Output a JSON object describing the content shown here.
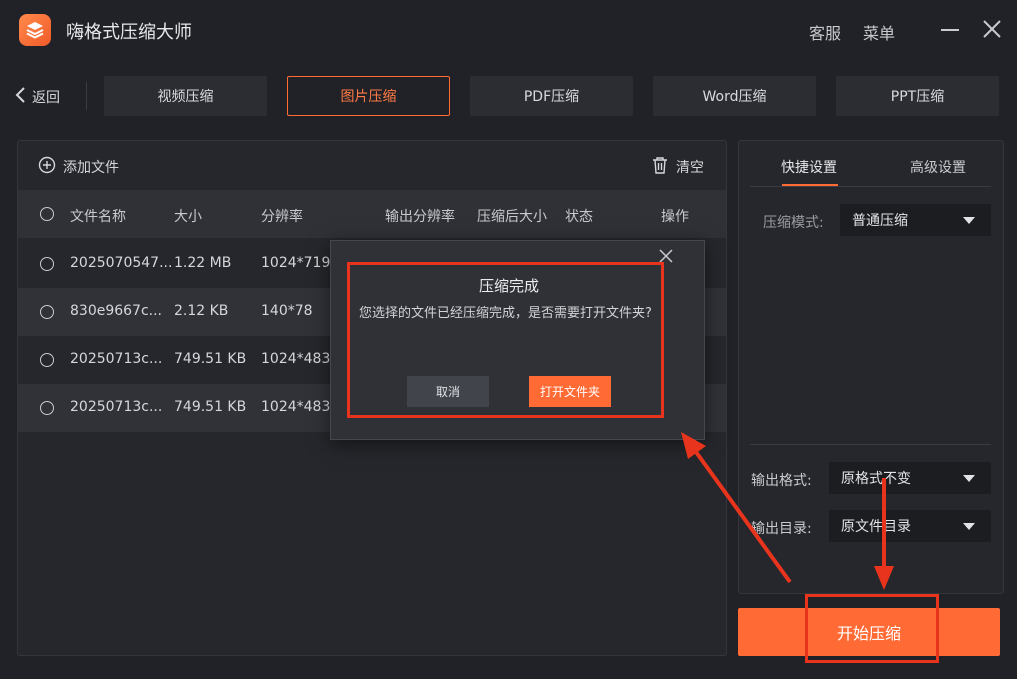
{
  "app": {
    "title": "嗨格式压缩大师"
  },
  "titlebar": {
    "customer_service": "客服",
    "menu": "菜单"
  },
  "nav": {
    "back_label": "返回",
    "tabs": [
      {
        "label": "视频压缩",
        "active": false
      },
      {
        "label": "图片压缩",
        "active": true
      },
      {
        "label": "PDF压缩",
        "active": false
      },
      {
        "label": "Word压缩",
        "active": false
      },
      {
        "label": "PPT压缩",
        "active": false
      }
    ]
  },
  "file_panel": {
    "add_file_label": "添加文件",
    "clear_label": "清空",
    "columns": {
      "name": "文件名称",
      "size": "大小",
      "resolution": "分辨率",
      "output_resolution": "输出分辨率",
      "compressed_size": "压缩后大小",
      "status": "状态",
      "action": "操作"
    },
    "rows": [
      {
        "name": "2025070547...",
        "size": "1.22 MB",
        "resolution": "1024*719"
      },
      {
        "name": "830e9667c...",
        "size": "2.12 KB",
        "resolution": "140*78"
      },
      {
        "name": "20250713c...",
        "size": "749.51 KB",
        "resolution": "1024*483"
      },
      {
        "name": "20250713c...",
        "size": "749.51 KB",
        "resolution": "1024*483"
      }
    ]
  },
  "settings": {
    "tab_quick": "快捷设置",
    "tab_advanced": "高级设置",
    "compression_mode_label": "压缩模式:",
    "compression_mode_value": "普通压缩",
    "output_format_label": "输出格式:",
    "output_format_value": "原格式不变",
    "output_dir_label": "输出目录:",
    "output_dir_value": "原文件目录"
  },
  "start_button_label": "开始压缩",
  "dialog": {
    "title": "压缩完成",
    "message": "您选择的文件已经压缩完成，是否需要打开文件夹?",
    "cancel_label": "取消",
    "open_folder_label": "打开文件夹"
  },
  "colors": {
    "accent": "#ff6a35",
    "annotation": "#e8341c",
    "background": "#202227"
  }
}
